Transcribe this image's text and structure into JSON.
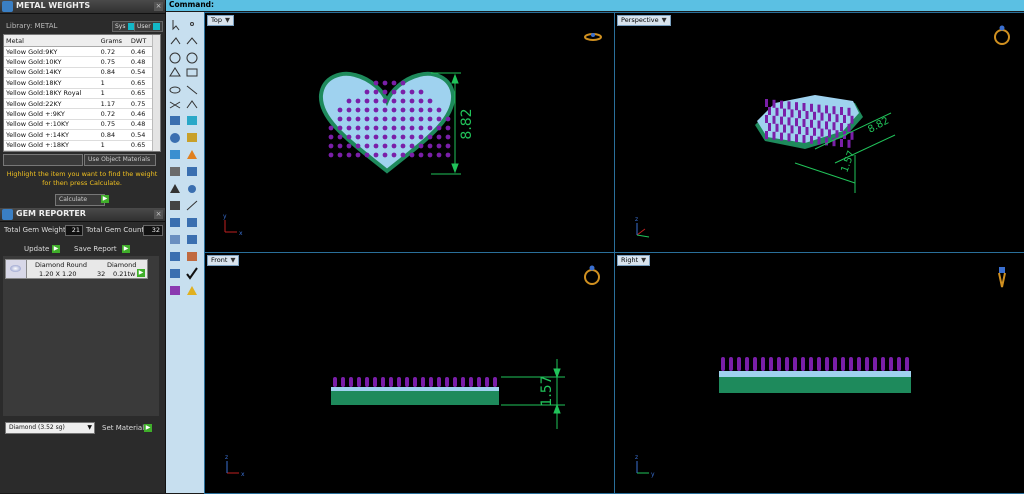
{
  "command_bar": {
    "label": "Command:"
  },
  "metal_panel": {
    "title": "METAL WEIGHTS",
    "library_label": "Library: METAL",
    "btn_sys": "Sys",
    "btn_user": "User",
    "columns": [
      "Metal",
      "Grams",
      "DWT"
    ],
    "rows": [
      [
        "Yellow Gold:9KY",
        "0.72",
        "0.46"
      ],
      [
        "Yellow Gold:10KY",
        "0.75",
        "0.48"
      ],
      [
        "Yellow Gold:14KY",
        "0.84",
        "0.54"
      ],
      [
        "Yellow Gold:18KY",
        "1",
        "0.65"
      ],
      [
        "Yellow Gold:18KY Royal",
        "1",
        "0.65"
      ],
      [
        "Yellow Gold:22KY",
        "1.17",
        "0.75"
      ],
      [
        "Yellow Gold +:9KY",
        "0.72",
        "0.46"
      ],
      [
        "Yellow Gold +:10KY",
        "0.75",
        "0.48"
      ],
      [
        "Yellow Gold +:14KY",
        "0.84",
        "0.54"
      ],
      [
        "Yellow Gold +:18KY",
        "1",
        "0.65"
      ],
      [
        "Yellow Gold +:18KY R...",
        "1",
        "0.65"
      ]
    ],
    "use_object_materials": "Use Object Materials",
    "hint": "Highlight the item you want to find the weight for then press Calculate.",
    "calculate": "Calculate"
  },
  "gem_panel": {
    "title": "GEM REPORTER",
    "total_weight_label": "Total Gem Weight",
    "total_weight_value": "21",
    "total_count_label": "Total Gem Count",
    "total_count_value": "32",
    "update": "Update",
    "save_report": "Save Report",
    "row": {
      "shape": "Diamond Round",
      "size": "1.20 X 1.20",
      "material": "Diamond",
      "count": "32",
      "weight": "0.21tw"
    },
    "material_select": "Diamond    (3.52 sg)",
    "set_material": "Set Material"
  },
  "viewports": {
    "top": {
      "label": "Top",
      "dimension": "8.82"
    },
    "perspective": {
      "label": "Perspective",
      "dimension_a": "8.82",
      "dimension_b": "1.57"
    },
    "front": {
      "label": "Front",
      "dimension": "1.57"
    },
    "right": {
      "label": "Right"
    }
  },
  "axis": {
    "x": "x",
    "y": "y",
    "z": "z"
  },
  "colors": {
    "metal": "#1e8a5c",
    "gem": "#9fd2ef",
    "prong": "#7a1fa8",
    "dimension": "#21c35a",
    "accent": "#5bc0e3"
  }
}
